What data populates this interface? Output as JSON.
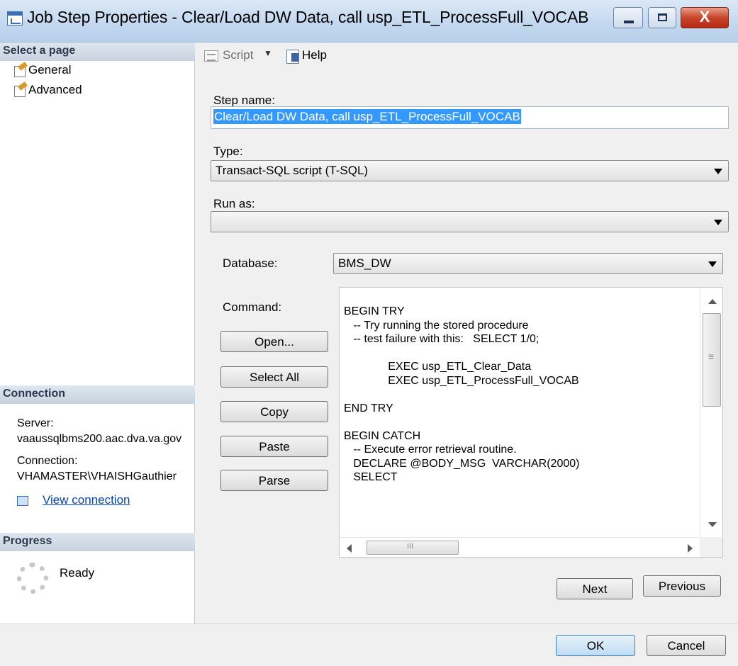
{
  "window": {
    "title": "Job Step Properties - Clear/Load DW Data, call usp_ETL_ProcessFull_VOCAB",
    "controls": {
      "minimize": "",
      "maximize": "",
      "close": "X"
    }
  },
  "left_panel": {
    "select_page_header": "Select a page",
    "pages": [
      {
        "label": "General",
        "icon": "page-settings-icon"
      },
      {
        "label": "Advanced",
        "icon": "page-settings-icon"
      }
    ],
    "connection_header": "Connection",
    "server_label": "Server:",
    "server_value": "vaaussqlbms200.aac.dva.va.gov",
    "connection_label": "Connection:",
    "connection_value": "VHAMASTER\\VHAISHGauthier",
    "view_connection_link": "View connection",
    "progress_header": "Progress",
    "progress_status": "Ready"
  },
  "toolbar": {
    "script_label": "Script",
    "help_label": "Help"
  },
  "form": {
    "step_name_label": "Step name:",
    "step_name_value": "Clear/Load DW Data, call usp_ETL_ProcessFull_VOCAB",
    "type_label": "Type:",
    "type_value": "Transact-SQL script (T-SQL)",
    "run_as_label": "Run as:",
    "run_as_value": "",
    "database_label": "Database:",
    "database_value": "BMS_DW",
    "command_label": "Command:",
    "command_text": "BEGIN TRY\n   -- Try running the stored procedure\n   -- test failure with this:   SELECT 1/0;\n\n              EXEC usp_ETL_Clear_Data\n              EXEC usp_ETL_ProcessFull_VOCAB\n\nEND TRY\n\nBEGIN CATCH\n   -- Execute error retrieval routine.\n   DECLARE @BODY_MSG  VARCHAR(2000)\n   SELECT",
    "buttons": {
      "open": "Open...",
      "select_all": "Select All",
      "copy": "Copy",
      "paste": "Paste",
      "parse": "Parse"
    },
    "next": "Next",
    "previous": "Previous"
  },
  "footer": {
    "ok": "OK",
    "cancel": "Cancel"
  }
}
